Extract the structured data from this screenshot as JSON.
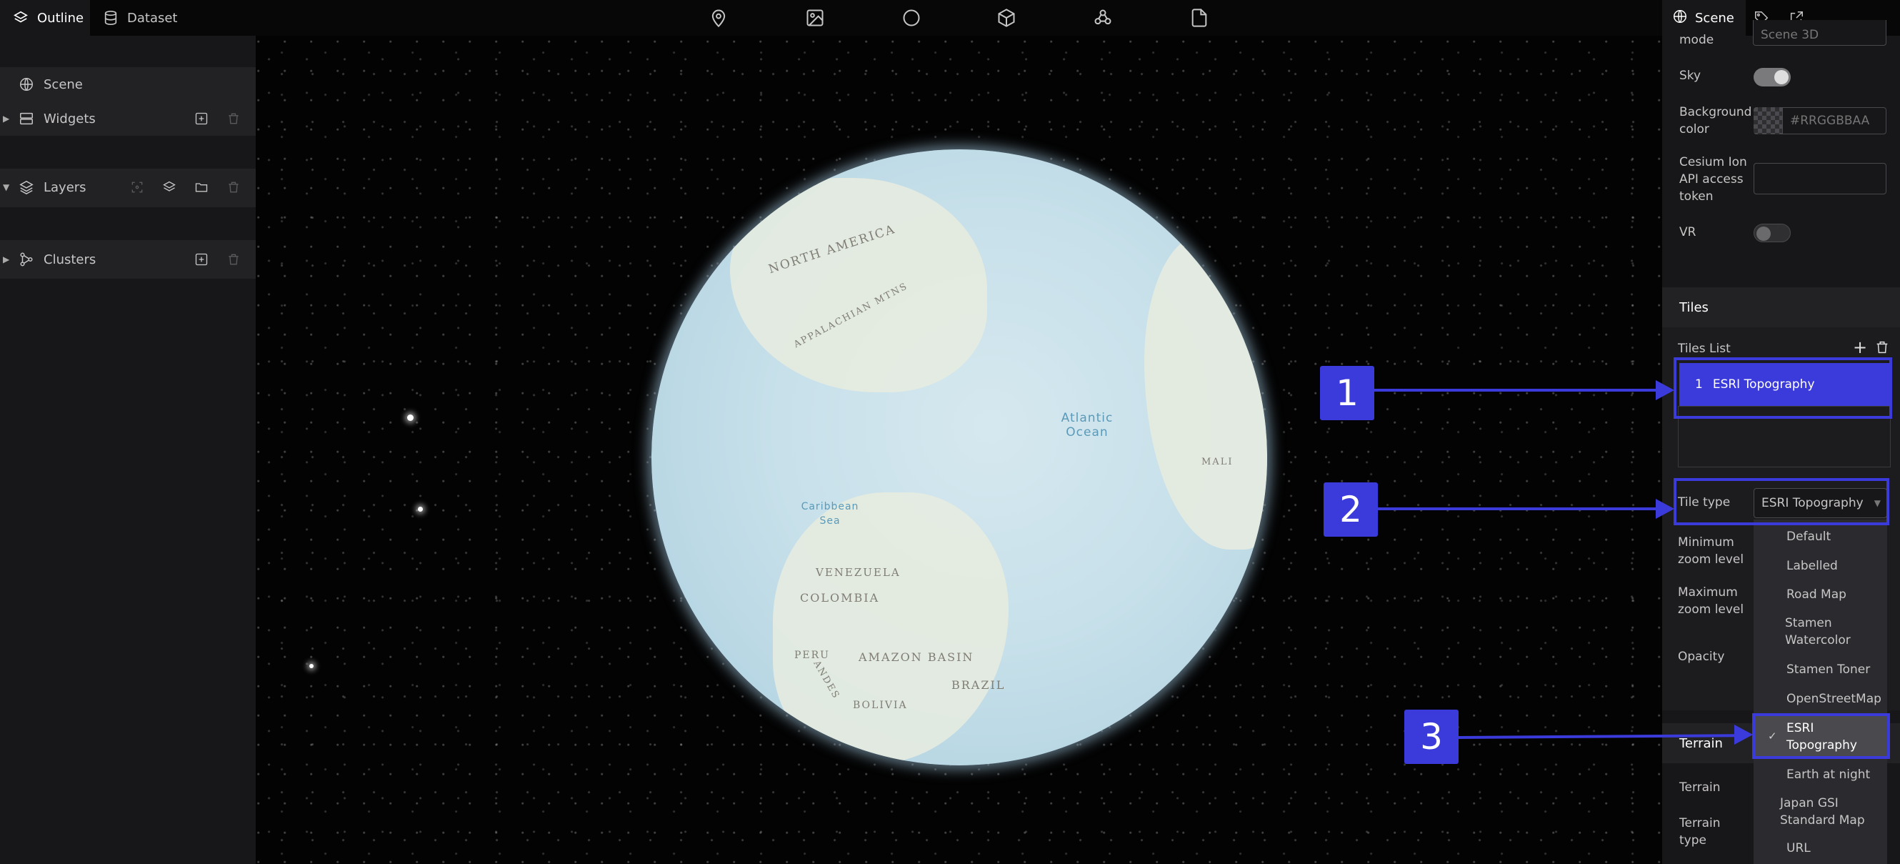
{
  "top_tabs": [
    {
      "label": "Outline",
      "icon": "layers-icon",
      "active": true
    },
    {
      "label": "Dataset",
      "icon": "database-icon",
      "active": false
    }
  ],
  "toolbar_icons": [
    "map-pin-icon",
    "image-icon",
    "circle-icon",
    "cube-icon",
    "cluster-icon",
    "file-icon"
  ],
  "left_panel": {
    "scene": {
      "label": "Scene",
      "icon": "globe-icon"
    },
    "widgets": {
      "label": "Widgets",
      "icon": "server-icon"
    },
    "layers": {
      "label": "Layers",
      "icon": "layers-icon"
    },
    "clusters": {
      "label": "Clusters",
      "icon": "cluster-icon"
    }
  },
  "globe_labels": {
    "north_america": "NORTH AMERICA",
    "appalachian": "APPALACHIAN MTNS",
    "atlantic_ocean": "Atlantic Ocean",
    "caribbean_sea": "Caribbean Sea",
    "venezuela": "VENEZUELA",
    "colombia": "COLOMBIA",
    "peru": "PERU",
    "amazon_basin": "AMAZON BASIN",
    "brazil": "BRAZIL",
    "bolivia": "BOLIVIA",
    "andes": "ANDES",
    "mali": "MALI"
  },
  "right_panel": {
    "tabs": [
      {
        "label": "Scene",
        "icon": "globe-icon",
        "active": true
      },
      {
        "label": "",
        "icon": "tag-icon",
        "active": false
      },
      {
        "label": "",
        "icon": "export-icon",
        "active": false
      }
    ],
    "mode": {
      "label": "mode",
      "value": "Scene 3D"
    },
    "sky": {
      "label": "Sky",
      "on": true
    },
    "background_color": {
      "label": "Background color",
      "placeholder": "#RRGGBBAA"
    },
    "cesium_token": {
      "label": "Cesium Ion API access token",
      "value": ""
    },
    "vr": {
      "label": "VR",
      "on": false
    },
    "tiles_header": "Tiles",
    "tiles_list_label": "Tiles List",
    "tiles": [
      {
        "index": "1",
        "name": "ESRI Topography"
      }
    ],
    "tile_type": {
      "label": "Tile type",
      "value": "ESRI Topography"
    },
    "min_zoom_label": "Minimum zoom level",
    "max_zoom_label": "Maximum zoom level",
    "opacity_label": "Opacity",
    "terrain_header": "Terrain",
    "terrain_label": "Terrain",
    "terrain_type_label": "Terrain type",
    "tile_type_options": [
      "Default",
      "Labelled",
      "Road Map",
      "Stamen Watercolor",
      "Stamen Toner",
      "OpenStreetMap",
      "ESRI Topography",
      "Earth at night",
      "Japan GSI Standard Map",
      "URL"
    ],
    "selected_option": "ESRI Topography"
  },
  "annotations": [
    "1",
    "2",
    "3"
  ],
  "accent_color": "#3b3bdc"
}
